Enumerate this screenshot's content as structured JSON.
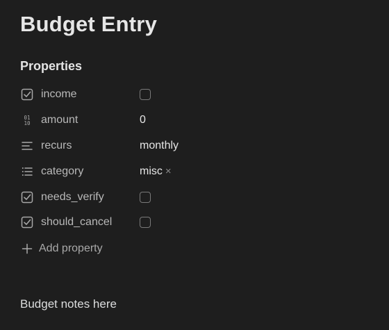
{
  "note": {
    "title": "Budget Entry",
    "body": "Budget notes here"
  },
  "properties_section": {
    "heading": "Properties",
    "add_label": "Add property",
    "items": [
      {
        "icon": "checkbox-icon",
        "name": "income",
        "type": "checkbox",
        "checked": false
      },
      {
        "icon": "number-icon",
        "name": "amount",
        "type": "number",
        "value": "0"
      },
      {
        "icon": "text-lines-icon",
        "name": "recurs",
        "type": "text",
        "value": "monthly"
      },
      {
        "icon": "list-icon",
        "name": "category",
        "type": "list",
        "value": "misc",
        "remove_glyph": "×"
      },
      {
        "icon": "checkbox-icon",
        "name": "needs_verify",
        "type": "checkbox",
        "checked": false
      },
      {
        "icon": "checkbox-icon",
        "name": "should_cancel",
        "type": "checkbox",
        "checked": false
      }
    ]
  },
  "colors": {
    "background": "#1e1e1e",
    "text": "#dcddde",
    "muted": "#b9b9b9"
  }
}
